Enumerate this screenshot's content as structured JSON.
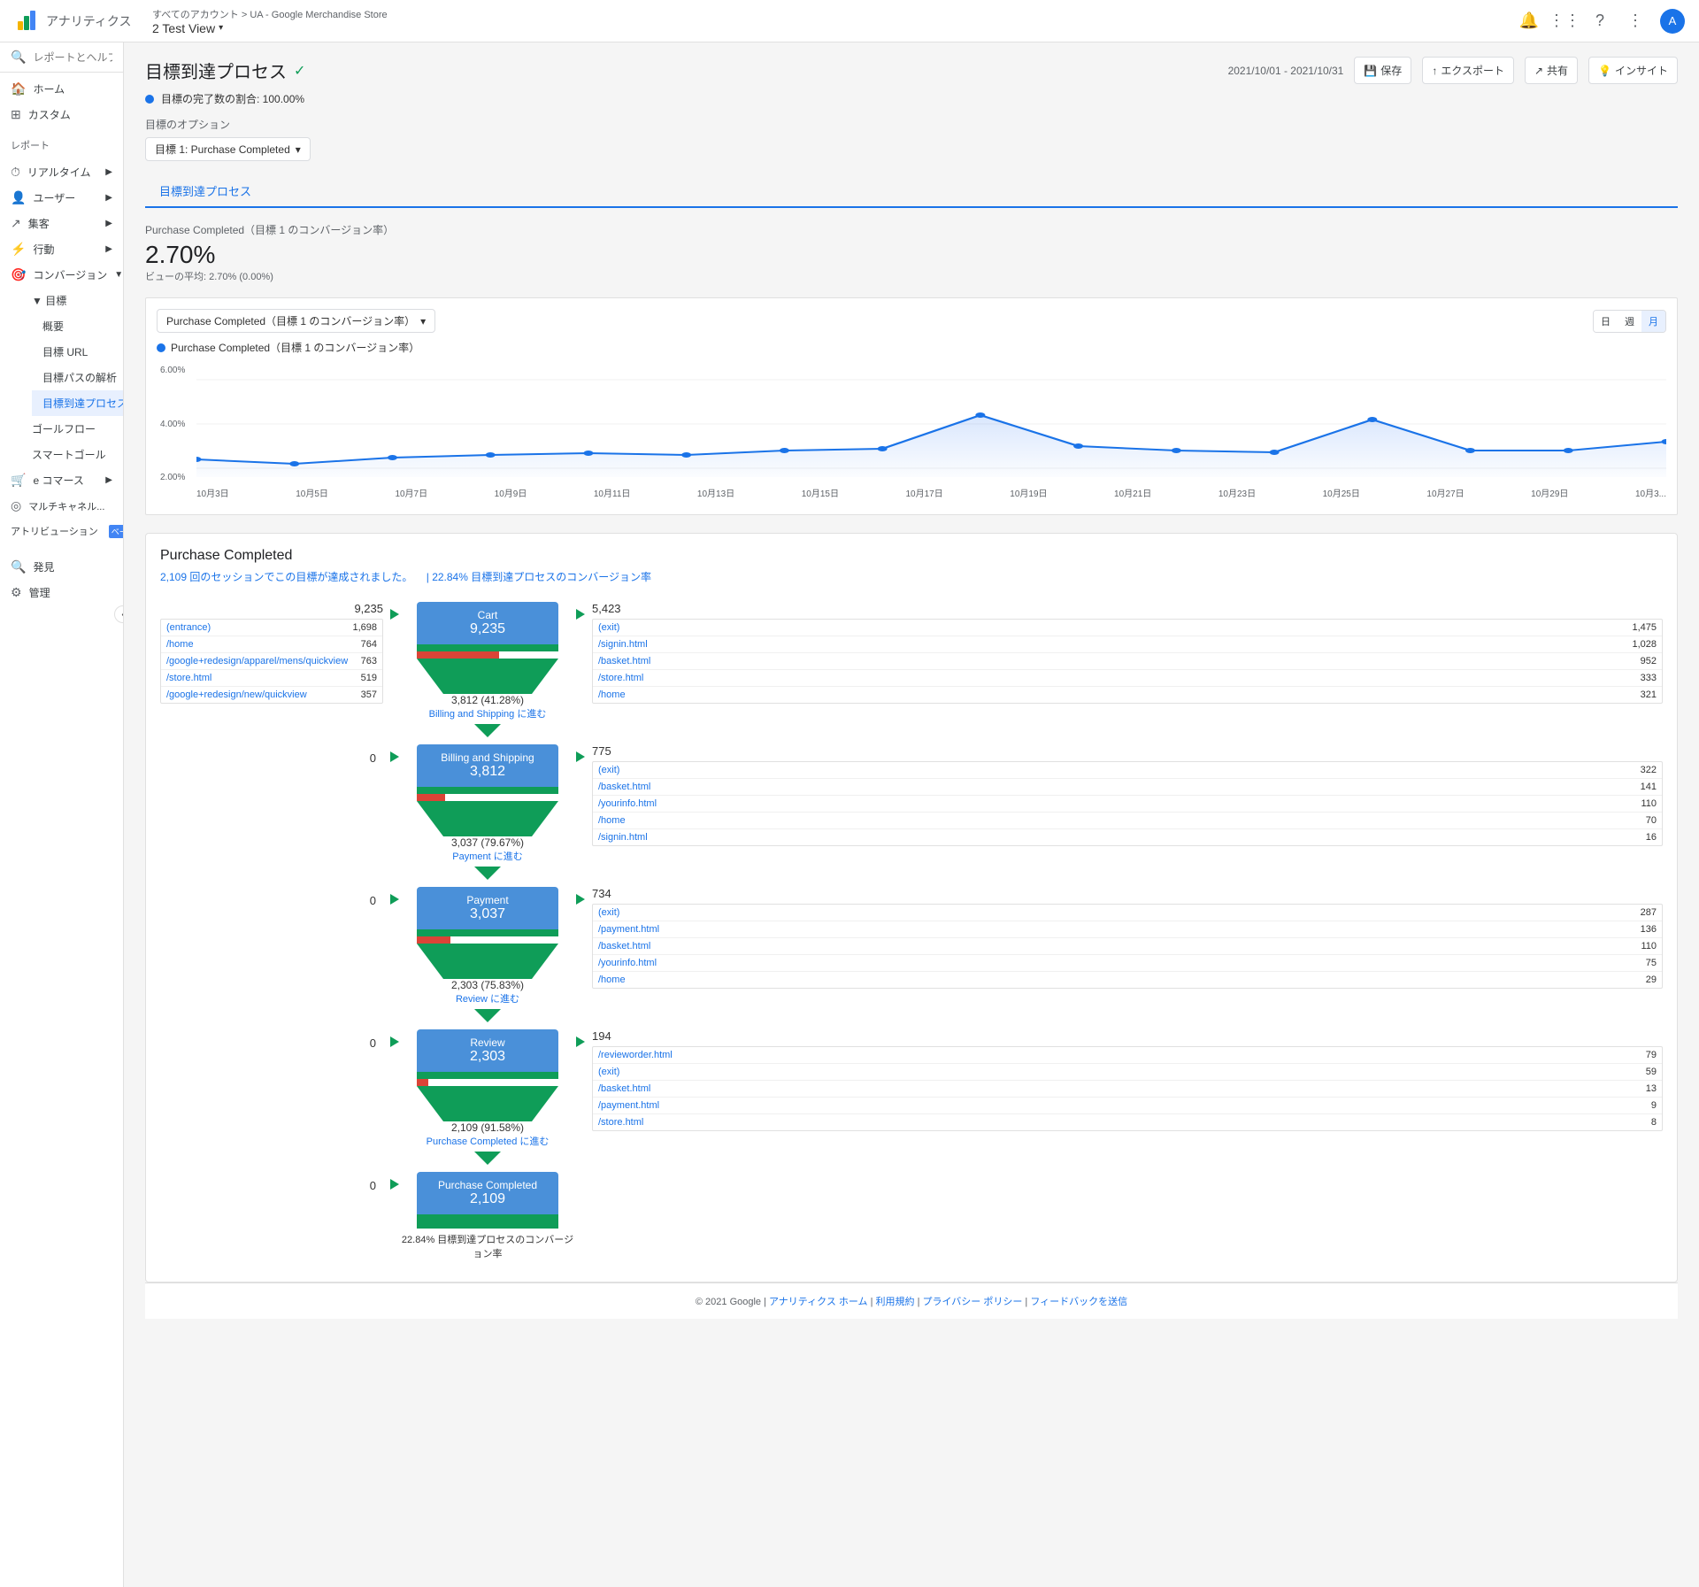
{
  "topbar": {
    "logo_text": "アナリティクス",
    "breadcrumb": "すべてのアカウント > UA - Google Merchandise Store",
    "account": "2 Test View",
    "icons": [
      "bell",
      "apps",
      "help",
      "menu"
    ],
    "avatar_text": "A"
  },
  "sidebar": {
    "search_placeholder": "レポートとヘルプを検索",
    "items": [
      {
        "label": "ホーム",
        "icon": "🏠",
        "id": "home"
      },
      {
        "label": "カスタム",
        "icon": "⊞",
        "id": "custom"
      }
    ],
    "group_label": "レポート",
    "sections": [
      {
        "label": "リアルタイム",
        "icon": "⏱",
        "id": "realtime",
        "expandable": true
      },
      {
        "label": "ユーザー",
        "icon": "👤",
        "id": "users",
        "expandable": true
      },
      {
        "label": "集客",
        "icon": "↗",
        "id": "acquisition",
        "expandable": true
      },
      {
        "label": "行動",
        "icon": "⚡",
        "id": "behavior",
        "expandable": true
      },
      {
        "label": "コンバージョン",
        "icon": "🎯",
        "id": "conversions",
        "expandable": true,
        "expanded": true,
        "children": [
          {
            "label": "目標",
            "id": "goals",
            "expanded": true,
            "children": [
              {
                "label": "概要",
                "id": "overview"
              },
              {
                "label": "目標 URL",
                "id": "goal-url"
              },
              {
                "label": "目標パスの解析",
                "id": "goal-path"
              },
              {
                "label": "目標到達プロセス",
                "id": "funnel-visualization",
                "active": true
              }
            ]
          },
          {
            "label": "ゴールフロー",
            "id": "goal-flow"
          },
          {
            "label": "スマートゴール",
            "id": "smart-goal"
          }
        ]
      },
      {
        "label": "e コマース",
        "icon": "🛒",
        "id": "ecommerce",
        "expandable": true
      },
      {
        "label": "マルチチャネル...",
        "icon": "⊕",
        "id": "multichannel"
      },
      {
        "label": "アトリビューション",
        "icon": "⊕",
        "id": "attribution"
      }
    ],
    "bottom_items": [
      {
        "label": "発見",
        "icon": "🔍",
        "id": "discover"
      },
      {
        "label": "管理",
        "icon": "⚙",
        "id": "admin"
      }
    ],
    "beta_badge": "ベータ版"
  },
  "page": {
    "title": "目標到達プロセス",
    "title_check": "✓",
    "goal_completion_label": "目標の完了数の割合: 100.00%",
    "date_range": "2021/10/01 - 2021/10/31",
    "options_label": "目標のオプション",
    "goal_dropdown": "目標 1: Purchase Completed",
    "tab_label": "目標到達プロセス",
    "conversion_label": "Purchase Completed（目標 1 のコンバージョン率）",
    "conversion_value": "2.70%",
    "conversion_compare": "ビューの平均: 2.70% (0.00%)",
    "chart_selector": "Purchase Completed（目標 1 のコンバージョン率）",
    "chart_period_btns": [
      "日",
      "週",
      "月"
    ],
    "chart_period_active": "日",
    "chart_legend": "Purchase Completed（目標 1 のコンバージョン率）",
    "chart_y_labels": [
      "6.00%",
      "4.00%",
      "2.00%"
    ],
    "chart_x_labels": [
      "10月3日",
      "10月5日",
      "10月7日",
      "10月9日",
      "10月11日",
      "10月13日",
      "10月15日",
      "10月17日",
      "10月19日",
      "10月21日",
      "10月23日",
      "10月25日",
      "10月27日",
      "10月29日",
      "10月3..."
    ],
    "header_btns": [
      "保存",
      "エクスポート",
      "共有",
      "インサイト"
    ]
  },
  "funnel": {
    "title": "Purchase Completed",
    "subtitle_sessions": "2,109",
    "subtitle_text": "回のセッションでこの目標が達成されました。",
    "subtitle_rate_label": "22.84% 目標到達プロセスのコンバージョン率",
    "stages": [
      {
        "id": "cart",
        "name": "Cart",
        "entries": 9235,
        "exits": 5423,
        "proceeding": 3812,
        "proceeding_pct": "41.28%",
        "next_stage": "Billing and Shipping に進む",
        "entry_sources": [
          {
            "path": "(entrance)",
            "count": "1,698"
          },
          {
            "path": "/home",
            "count": "764"
          },
          {
            "path": "/google+redesign/apparel/mens/quickview",
            "count": "763"
          },
          {
            "path": "/store.html",
            "count": "519"
          },
          {
            "path": "/google+redesign/new/quickview",
            "count": "357"
          }
        ],
        "exit_destinations": [
          {
            "path": "(exit)",
            "count": "1,475"
          },
          {
            "path": "/signin.html",
            "count": "1,028"
          },
          {
            "path": "/basket.html",
            "count": "952"
          },
          {
            "path": "/store.html",
            "count": "333"
          },
          {
            "path": "/home",
            "count": "321"
          }
        ]
      },
      {
        "id": "billing",
        "name": "Billing and Shipping",
        "entries": 3812,
        "entry_from_other": 0,
        "exits": 775,
        "proceeding": 3037,
        "proceeding_pct": "79.67%",
        "next_stage": "Payment に進む",
        "exit_destinations": [
          {
            "path": "(exit)",
            "count": "322"
          },
          {
            "path": "/basket.html",
            "count": "141"
          },
          {
            "path": "/yourinfo.html",
            "count": "110"
          },
          {
            "path": "/home",
            "count": "70"
          },
          {
            "path": "/signin.html",
            "count": "16"
          }
        ]
      },
      {
        "id": "payment",
        "name": "Payment",
        "entries": 3037,
        "entry_from_other": 0,
        "exits": 734,
        "proceeding": 2303,
        "proceeding_pct": "75.83%",
        "next_stage": "Review に進む",
        "exit_destinations": [
          {
            "path": "(exit)",
            "count": "287"
          },
          {
            "path": "/payment.html",
            "count": "136"
          },
          {
            "path": "/basket.html",
            "count": "110"
          },
          {
            "path": "/yourinfo.html",
            "count": "75"
          },
          {
            "path": "/home",
            "count": "29"
          }
        ]
      },
      {
        "id": "review",
        "name": "Review",
        "entries": 2303,
        "entry_from_other": 0,
        "exits": 194,
        "proceeding": 2109,
        "proceeding_pct": "91.58%",
        "next_stage": "Purchase Completed に進む",
        "exit_destinations": [
          {
            "path": "/revieworder.html",
            "count": "79"
          },
          {
            "path": "(exit)",
            "count": "59"
          },
          {
            "path": "/basket.html",
            "count": "13"
          },
          {
            "path": "/payment.html",
            "count": "9"
          },
          {
            "path": "/store.html",
            "count": "8"
          }
        ]
      },
      {
        "id": "purchase-completed",
        "name": "Purchase Completed",
        "entries": 2109,
        "entry_from_other": 0,
        "rate_label": "22.84% 目標到達プロセスのコンバージョン率"
      }
    ]
  },
  "footer": {
    "text": "© 2021 Google",
    "links": [
      "アナリティクス ホーム",
      "利用規約",
      "プライバシー ポリシー",
      "フィードバックを送信"
    ]
  }
}
